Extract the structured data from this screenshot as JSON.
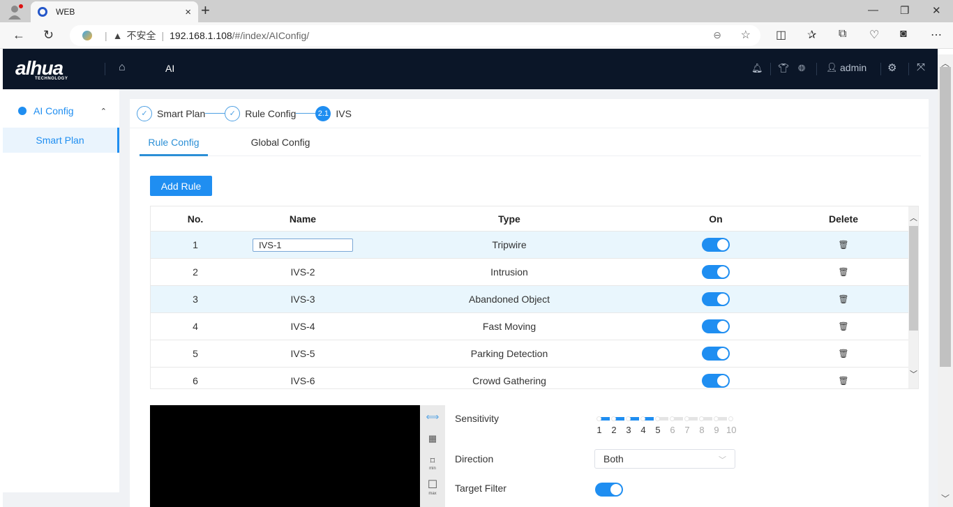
{
  "browser": {
    "tab_title": "WEB",
    "close_tab": "×",
    "new_tab": "+",
    "security_label": "不安全",
    "url_host": "192.168.1.108",
    "url_path": "/#/index/AIConfig/",
    "window_controls": {
      "minimize": "—",
      "restore": "❐",
      "close": "✕"
    }
  },
  "app": {
    "brand": "alhua",
    "brand_sub": "TECHNOLOGY",
    "nav_current": "AI",
    "user": "admin"
  },
  "sidebar": {
    "group_label": "AI Config",
    "items": [
      {
        "label": "Smart Plan",
        "active": true
      }
    ]
  },
  "steps": [
    {
      "label": "Smart Plan",
      "status": "done"
    },
    {
      "label": "Rule Config",
      "status": "done"
    },
    {
      "label": "IVS",
      "status": "current",
      "number": "2.1"
    }
  ],
  "tabs": [
    {
      "label": "Rule Config",
      "active": true
    },
    {
      "label": "Global Config",
      "active": false
    }
  ],
  "add_rule_label": "Add Rule",
  "table": {
    "headers": {
      "no": "No.",
      "name": "Name",
      "type": "Type",
      "on": "On",
      "delete": "Delete"
    },
    "rows": [
      {
        "no": "1",
        "name": "IVS-1",
        "type": "Tripwire",
        "on": true,
        "editing": true
      },
      {
        "no": "2",
        "name": "IVS-2",
        "type": "Intrusion",
        "on": true
      },
      {
        "no": "3",
        "name": "IVS-3",
        "type": "Abandoned Object",
        "on": true
      },
      {
        "no": "4",
        "name": "IVS-4",
        "type": "Fast Moving",
        "on": true
      },
      {
        "no": "5",
        "name": "IVS-5",
        "type": "Parking Detection",
        "on": true
      },
      {
        "no": "6",
        "name": "IVS-6",
        "type": "Crowd Gathering",
        "on": true
      }
    ]
  },
  "video_tools": [
    {
      "icon": "draw-rule-icon",
      "glyph": "⟺"
    },
    {
      "icon": "grid-icon",
      "glyph": "▦"
    },
    {
      "icon": "min-size-icon",
      "glyph": "⌑",
      "caption": "min"
    },
    {
      "icon": "max-size-icon",
      "glyph": "☐",
      "caption": "max"
    }
  ],
  "settings": {
    "sensitivity_label": "Sensitivity",
    "sensitivity_value": 5,
    "sensitivity_scale": [
      "1",
      "2",
      "3",
      "4",
      "5",
      "6",
      "7",
      "8",
      "9",
      "10"
    ],
    "direction_label": "Direction",
    "direction_value": "Both",
    "target_filter_label": "Target Filter",
    "target_filter_on": true
  },
  "colors": {
    "accent": "#1f8ef1",
    "header_bg": "#0b1628",
    "row_highlight": "#e9f6fd"
  }
}
